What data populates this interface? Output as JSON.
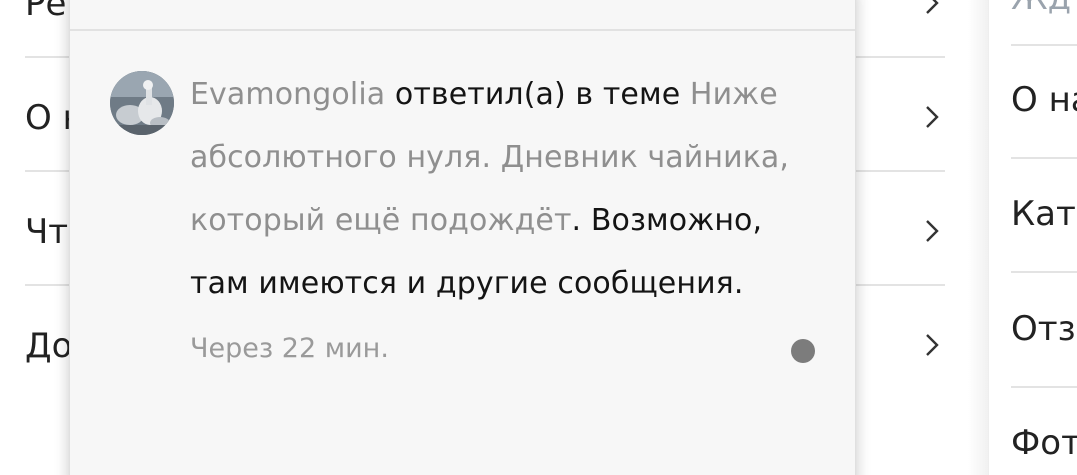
{
  "left_menu": {
    "items": [
      {
        "label": "Ре"
      },
      {
        "label": "О н"
      },
      {
        "label": "Чт"
      },
      {
        "label": "До"
      }
    ]
  },
  "right_menu": {
    "items": [
      {
        "label": "Жд"
      },
      {
        "label": "О на"
      },
      {
        "label": "Кат"
      },
      {
        "label": "Отз"
      },
      {
        "label": "Фот"
      }
    ]
  },
  "notification": {
    "user": "Evamongolia",
    "action": " ответил(а) в теме ",
    "topic": "Ниже абсолютного нуля. Дневник чайника, который ещё подождёт",
    "suffix": ". Возможно, там имеются и другие сообщения.",
    "time": "Через 22 мин.",
    "unread": true
  },
  "colors": {
    "muted_link": "#8f8f8f",
    "unread_dot": "#7c7c7c"
  }
}
